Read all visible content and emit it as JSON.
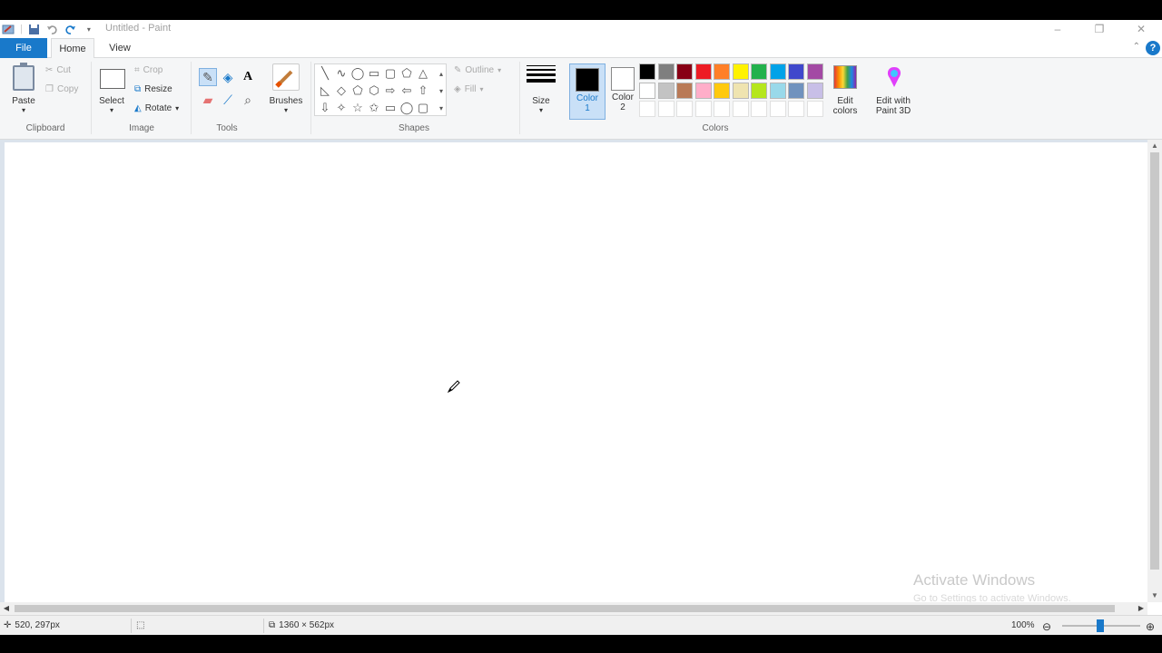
{
  "window": {
    "title": "Untitled - Paint",
    "minimize": "–",
    "maximize": "❐",
    "close": "✕"
  },
  "tabs": {
    "file": "File",
    "home": "Home",
    "view": "View"
  },
  "clipboard": {
    "paste": "Paste",
    "cut": "Cut",
    "copy": "Copy",
    "group_label": "Clipboard"
  },
  "image": {
    "select": "Select",
    "crop": "Crop",
    "resize": "Resize",
    "rotate": "Rotate",
    "group_label": "Image"
  },
  "tools": {
    "group_label": "Tools",
    "brushes": "Brushes"
  },
  "shapes": {
    "outline": "Outline",
    "fill": "Fill",
    "group_label": "Shapes",
    "items": [
      "╲",
      "∿",
      "◯",
      "▭",
      "▢",
      "⬠",
      "△",
      "◺",
      "◇",
      "⬠",
      "⬡",
      "⇨",
      "⇦",
      "⇧",
      "⇩",
      "✧",
      "☆",
      "✩",
      "▭",
      "◯",
      "▢"
    ]
  },
  "size": {
    "label": "Size"
  },
  "colors": {
    "color1_label": "Color",
    "color1_num": "1",
    "color2_label": "Color",
    "color2_num": "2",
    "color1_value": "#000000",
    "color2_value": "#ffffff",
    "edit_colors": "Edit colors",
    "edit_with_paint3d": "Edit with Paint 3D",
    "group_label": "Colors",
    "palette_row1": [
      "#000000",
      "#7f7f7f",
      "#880015",
      "#ed1c24",
      "#ff7f27",
      "#fff200",
      "#22b14c",
      "#00a2e8",
      "#3f48cc",
      "#a349a4"
    ],
    "palette_row2": [
      "#ffffff",
      "#c3c3c3",
      "#b97a57",
      "#ffaec9",
      "#ffc90e",
      "#efe4b0",
      "#b5e61d",
      "#99d9ea",
      "#7092be",
      "#c8bfe7"
    ],
    "palette_row3": [
      "#ffffff",
      "#ffffff",
      "#ffffff",
      "#ffffff",
      "#ffffff",
      "#ffffff",
      "#ffffff",
      "#ffffff",
      "#ffffff",
      "#ffffff"
    ]
  },
  "watermark": {
    "line1": "Activate Windows",
    "line2": "Go to Settings to activate Windows."
  },
  "status": {
    "cursor_pos": "520, 297px",
    "canvas_size": "1360 × 562px",
    "zoom": "100%",
    "zoom_level_percent": 100
  }
}
